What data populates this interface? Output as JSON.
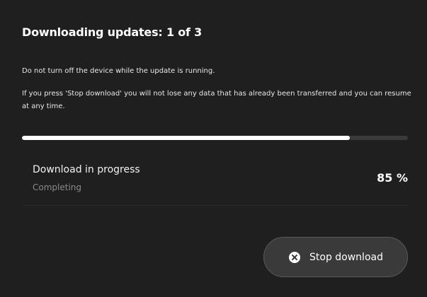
{
  "dialog": {
    "title": "Downloading updates: 1 of 3",
    "note_1": "Do not turn off the device while the update is running.",
    "note_2": "If you press 'Stop download' you will not lose any data that has already been transferred and you can resume at any time."
  },
  "progress": {
    "fraction": 0.85,
    "status_label": "Download in progress",
    "status_sub": "Completing",
    "percent_text": "85 %"
  },
  "actions": {
    "stop_label": "Stop download",
    "stop_icon": "close-circle-icon"
  }
}
